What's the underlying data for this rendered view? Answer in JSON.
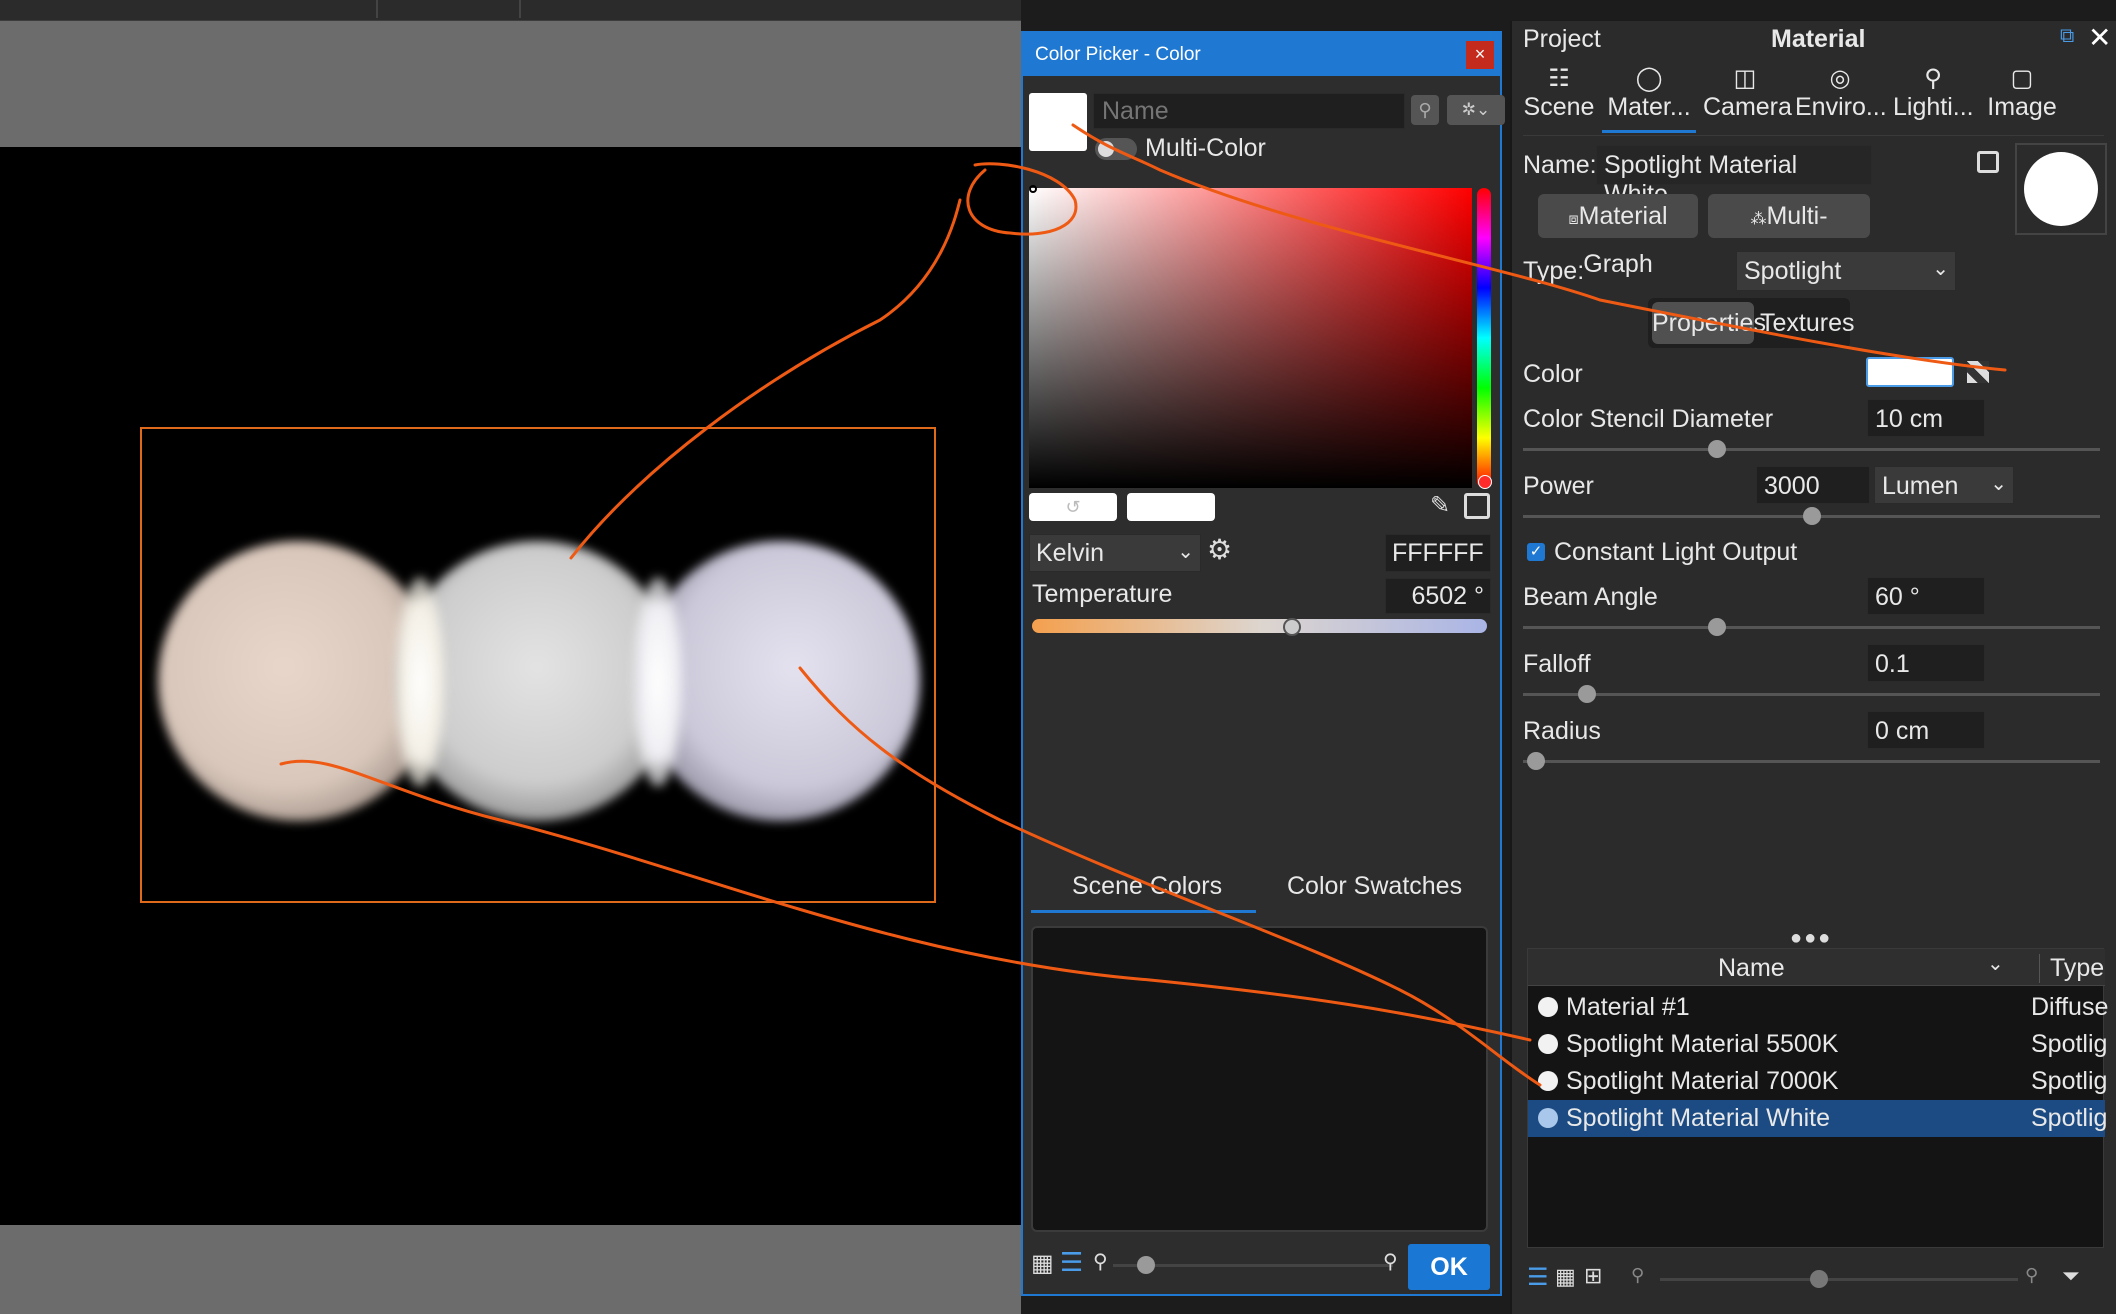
{
  "colors": {
    "accent": "#1f78d1",
    "annotation": "#ee5a14",
    "selected_row": "#1b4b82",
    "bbox": "#e06a1c"
  },
  "picker": {
    "title": "Color Picker - Color",
    "close": "×",
    "name_placeholder": "Name",
    "multicolor_label": "Multi-Color",
    "mode": "Kelvin",
    "hex": "FFFFFF",
    "temperature_label": "Temperature",
    "temperature_value": "6502 °",
    "temperature_fraction": 0.57,
    "tabs": [
      "Scene Colors",
      "Color Swatches"
    ],
    "ok": "OK"
  },
  "right": {
    "tabs_header": {
      "project": "Project",
      "material": "Material"
    },
    "tabs": [
      {
        "label": "Scene",
        "icon": "scene-icon"
      },
      {
        "label": "Mater...",
        "icon": "material-icon"
      },
      {
        "label": "Camera",
        "icon": "camera-icon"
      },
      {
        "label": "Enviro...",
        "icon": "environment-icon"
      },
      {
        "label": "Lighti...",
        "icon": "lighting-icon"
      },
      {
        "label": "Image",
        "icon": "image-icon"
      }
    ],
    "name_label": "Name:",
    "name_value": "Spotlight Material White",
    "material_graph": "Material Graph",
    "multi_material": "Multi-Material",
    "type_label": "Type:",
    "type_value": "Spotlight",
    "sub_tabs": [
      "Properties",
      "Textures"
    ],
    "color_label": "Color",
    "stencil_label": "Color Stencil Diameter",
    "stencil_value": "10 cm",
    "power_label": "Power",
    "power_value": "3000",
    "power_unit": "Lumen",
    "constant_label": "Constant Light Output",
    "beam_label": "Beam Angle",
    "beam_value": "60 °",
    "falloff_label": "Falloff",
    "falloff_value": "0.1",
    "radius_label": "Radius",
    "radius_value": "0 cm",
    "list_header": {
      "name": "Name",
      "type": "Type"
    },
    "materials": [
      {
        "name": "Material #1",
        "type": "Diffuse"
      },
      {
        "name": "Spotlight Material 5500K",
        "type": "Spotlig"
      },
      {
        "name": "Spotlight Material 7000K",
        "type": "Spotlig"
      },
      {
        "name": "Spotlight Material White",
        "type": "Spotlig"
      }
    ]
  }
}
